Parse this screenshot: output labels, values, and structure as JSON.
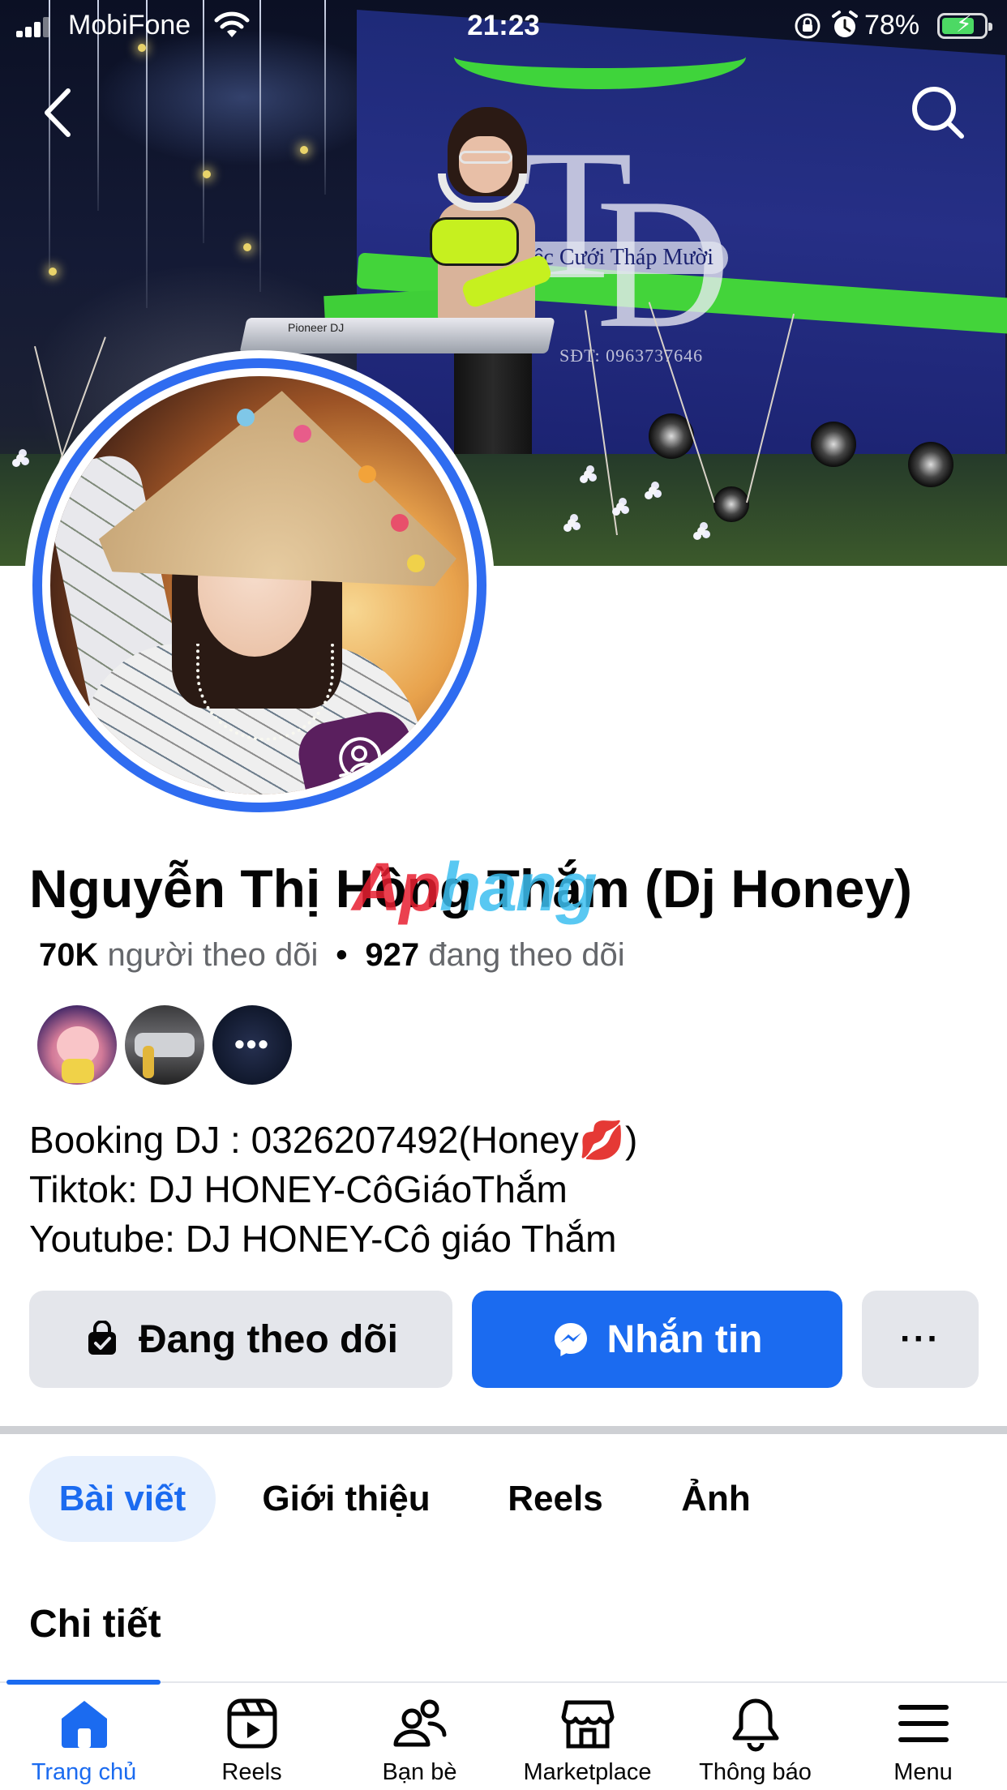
{
  "status_bar": {
    "carrier": "MobiFone",
    "time": "21:23",
    "battery": "78%",
    "battery_level": 0.78
  },
  "header": {
    "back_icon": "chevron-left-icon",
    "search_icon": "search-icon"
  },
  "cover": {
    "banner_text": "ệc Cưới Tháp Mười",
    "banner_phone": "SĐT: 0963737646",
    "deck_brand": "Pioneer DJ"
  },
  "profile": {
    "name": "Nguyễn Thị Hồng Thắm (Dj Honey)",
    "followers_count": "70K",
    "followers_label": "người theo dõi",
    "separator": "•",
    "following_count": "927",
    "following_label": "đang theo dõi",
    "mutual_more": "•••",
    "bio": [
      "Booking DJ : 0326207492(Honey💋)",
      "Tiktok: DJ HONEY-CôGiáoThắm",
      "Youtube: DJ HONEY-Cô giáo Thắm"
    ]
  },
  "watermark": {
    "part_a": "Ap",
    "part_b": "hang"
  },
  "actions": {
    "follow_label": "Đang theo dõi",
    "message_label": "Nhắn tin",
    "more_label": "···"
  },
  "tabs": [
    {
      "label": "Bài viết",
      "active": true
    },
    {
      "label": "Giới thiệu",
      "active": false
    },
    {
      "label": "Reels",
      "active": false
    },
    {
      "label": "Ảnh",
      "active": false
    }
  ],
  "section": {
    "title": "Chi tiết"
  },
  "bottom_nav": [
    {
      "label": "Trang chủ",
      "icon": "home-icon",
      "active": true
    },
    {
      "label": "Reels",
      "icon": "reels-icon",
      "active": false
    },
    {
      "label": "Bạn bè",
      "icon": "friends-icon",
      "active": false
    },
    {
      "label": "Marketplace",
      "icon": "marketplace-icon",
      "active": false
    },
    {
      "label": "Thông báo",
      "icon": "bell-icon",
      "active": false
    },
    {
      "label": "Menu",
      "icon": "menu-icon",
      "active": false
    }
  ],
  "colors": {
    "accent": "#1b6bf0",
    "avatar_ring": "#2f6cf0",
    "button_gray": "#e4e6eb",
    "tab_active_bg": "#e7f0fd",
    "battery_green": "#4cd964",
    "banner_green": "#43d43a"
  }
}
